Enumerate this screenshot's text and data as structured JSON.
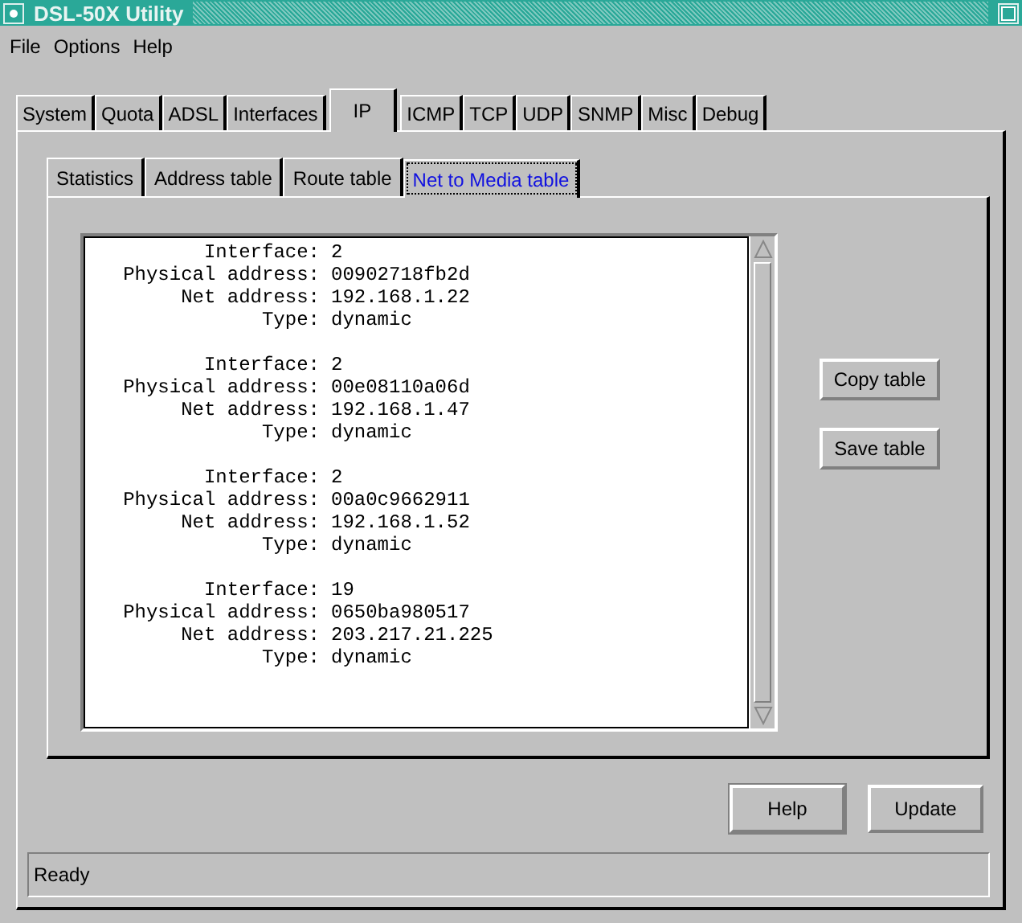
{
  "window": {
    "title": "DSL-50X Utility"
  },
  "menu": [
    "File",
    "Options",
    "Help"
  ],
  "tabs": [
    {
      "label": "System",
      "selected": false
    },
    {
      "label": "Quota",
      "selected": false
    },
    {
      "label": "ADSL",
      "selected": false
    },
    {
      "label": "Interfaces",
      "selected": false
    },
    {
      "label": "IP",
      "selected": true
    },
    {
      "label": "ICMP",
      "selected": false
    },
    {
      "label": "TCP",
      "selected": false
    },
    {
      "label": "UDP",
      "selected": false
    },
    {
      "label": "SNMP",
      "selected": false
    },
    {
      "label": "Misc",
      "selected": false
    },
    {
      "label": "Debug",
      "selected": false
    }
  ],
  "subtabs": [
    {
      "label": "Statistics",
      "selected": false
    },
    {
      "label": "Address table",
      "selected": false
    },
    {
      "label": "Route table",
      "selected": false
    },
    {
      "label": "Net to Media table",
      "selected": true
    }
  ],
  "entries": [
    [
      {
        "label": "Interface:",
        "value": "2"
      },
      {
        "label": "Physical address:",
        "value": "00902718fb2d"
      },
      {
        "label": "Net address:",
        "value": "192.168.1.22"
      },
      {
        "label": "Type:",
        "value": "dynamic"
      }
    ],
    [
      {
        "label": "Interface:",
        "value": "2"
      },
      {
        "label": "Physical address:",
        "value": "00e08110a06d"
      },
      {
        "label": "Net address:",
        "value": "192.168.1.47"
      },
      {
        "label": "Type:",
        "value": "dynamic"
      }
    ],
    [
      {
        "label": "Interface:",
        "value": "2"
      },
      {
        "label": "Physical address:",
        "value": "00a0c9662911"
      },
      {
        "label": "Net address:",
        "value": "192.168.1.52"
      },
      {
        "label": "Type:",
        "value": "dynamic"
      }
    ],
    [
      {
        "label": "Interface:",
        "value": "19"
      },
      {
        "label": "Physical address:",
        "value": "0650ba980517"
      },
      {
        "label": "Net address:",
        "value": "203.217.21.225"
      },
      {
        "label": "Type:",
        "value": "dynamic"
      }
    ]
  ],
  "side_buttons": [
    "Copy table",
    "Save table"
  ],
  "buttons": [
    {
      "label": "Help",
      "default": true
    },
    {
      "label": "Update",
      "default": false
    }
  ],
  "status_bar": "Ready"
}
